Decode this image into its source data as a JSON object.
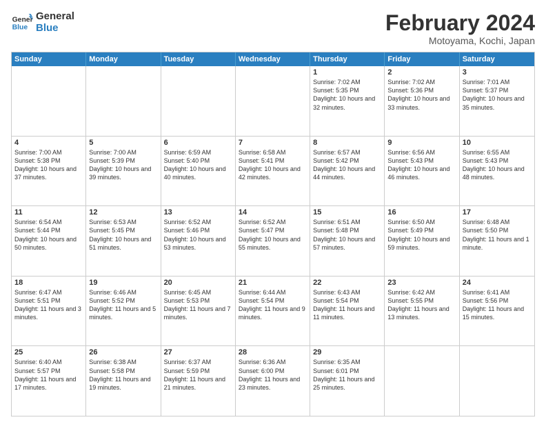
{
  "logo": {
    "line1": "General",
    "line2": "Blue"
  },
  "title": "February 2024",
  "location": "Motoyama, Kochi, Japan",
  "weekdays": [
    "Sunday",
    "Monday",
    "Tuesday",
    "Wednesday",
    "Thursday",
    "Friday",
    "Saturday"
  ],
  "weeks": [
    [
      {
        "day": "",
        "info": ""
      },
      {
        "day": "",
        "info": ""
      },
      {
        "day": "",
        "info": ""
      },
      {
        "day": "",
        "info": ""
      },
      {
        "day": "1",
        "info": "Sunrise: 7:02 AM\nSunset: 5:35 PM\nDaylight: 10 hours\nand 32 minutes."
      },
      {
        "day": "2",
        "info": "Sunrise: 7:02 AM\nSunset: 5:36 PM\nDaylight: 10 hours\nand 33 minutes."
      },
      {
        "day": "3",
        "info": "Sunrise: 7:01 AM\nSunset: 5:37 PM\nDaylight: 10 hours\nand 35 minutes."
      }
    ],
    [
      {
        "day": "4",
        "info": "Sunrise: 7:00 AM\nSunset: 5:38 PM\nDaylight: 10 hours\nand 37 minutes."
      },
      {
        "day": "5",
        "info": "Sunrise: 7:00 AM\nSunset: 5:39 PM\nDaylight: 10 hours\nand 39 minutes."
      },
      {
        "day": "6",
        "info": "Sunrise: 6:59 AM\nSunset: 5:40 PM\nDaylight: 10 hours\nand 40 minutes."
      },
      {
        "day": "7",
        "info": "Sunrise: 6:58 AM\nSunset: 5:41 PM\nDaylight: 10 hours\nand 42 minutes."
      },
      {
        "day": "8",
        "info": "Sunrise: 6:57 AM\nSunset: 5:42 PM\nDaylight: 10 hours\nand 44 minutes."
      },
      {
        "day": "9",
        "info": "Sunrise: 6:56 AM\nSunset: 5:43 PM\nDaylight: 10 hours\nand 46 minutes."
      },
      {
        "day": "10",
        "info": "Sunrise: 6:55 AM\nSunset: 5:43 PM\nDaylight: 10 hours\nand 48 minutes."
      }
    ],
    [
      {
        "day": "11",
        "info": "Sunrise: 6:54 AM\nSunset: 5:44 PM\nDaylight: 10 hours\nand 50 minutes."
      },
      {
        "day": "12",
        "info": "Sunrise: 6:53 AM\nSunset: 5:45 PM\nDaylight: 10 hours\nand 51 minutes."
      },
      {
        "day": "13",
        "info": "Sunrise: 6:52 AM\nSunset: 5:46 PM\nDaylight: 10 hours\nand 53 minutes."
      },
      {
        "day": "14",
        "info": "Sunrise: 6:52 AM\nSunset: 5:47 PM\nDaylight: 10 hours\nand 55 minutes."
      },
      {
        "day": "15",
        "info": "Sunrise: 6:51 AM\nSunset: 5:48 PM\nDaylight: 10 hours\nand 57 minutes."
      },
      {
        "day": "16",
        "info": "Sunrise: 6:50 AM\nSunset: 5:49 PM\nDaylight: 10 hours\nand 59 minutes."
      },
      {
        "day": "17",
        "info": "Sunrise: 6:48 AM\nSunset: 5:50 PM\nDaylight: 11 hours\nand 1 minute."
      }
    ],
    [
      {
        "day": "18",
        "info": "Sunrise: 6:47 AM\nSunset: 5:51 PM\nDaylight: 11 hours\nand 3 minutes."
      },
      {
        "day": "19",
        "info": "Sunrise: 6:46 AM\nSunset: 5:52 PM\nDaylight: 11 hours\nand 5 minutes."
      },
      {
        "day": "20",
        "info": "Sunrise: 6:45 AM\nSunset: 5:53 PM\nDaylight: 11 hours\nand 7 minutes."
      },
      {
        "day": "21",
        "info": "Sunrise: 6:44 AM\nSunset: 5:54 PM\nDaylight: 11 hours\nand 9 minutes."
      },
      {
        "day": "22",
        "info": "Sunrise: 6:43 AM\nSunset: 5:54 PM\nDaylight: 11 hours\nand 11 minutes."
      },
      {
        "day": "23",
        "info": "Sunrise: 6:42 AM\nSunset: 5:55 PM\nDaylight: 11 hours\nand 13 minutes."
      },
      {
        "day": "24",
        "info": "Sunrise: 6:41 AM\nSunset: 5:56 PM\nDaylight: 11 hours\nand 15 minutes."
      }
    ],
    [
      {
        "day": "25",
        "info": "Sunrise: 6:40 AM\nSunset: 5:57 PM\nDaylight: 11 hours\nand 17 minutes."
      },
      {
        "day": "26",
        "info": "Sunrise: 6:38 AM\nSunset: 5:58 PM\nDaylight: 11 hours\nand 19 minutes."
      },
      {
        "day": "27",
        "info": "Sunrise: 6:37 AM\nSunset: 5:59 PM\nDaylight: 11 hours\nand 21 minutes."
      },
      {
        "day": "28",
        "info": "Sunrise: 6:36 AM\nSunset: 6:00 PM\nDaylight: 11 hours\nand 23 minutes."
      },
      {
        "day": "29",
        "info": "Sunrise: 6:35 AM\nSunset: 6:01 PM\nDaylight: 11 hours\nand 25 minutes."
      },
      {
        "day": "",
        "info": ""
      },
      {
        "day": "",
        "info": ""
      }
    ]
  ]
}
